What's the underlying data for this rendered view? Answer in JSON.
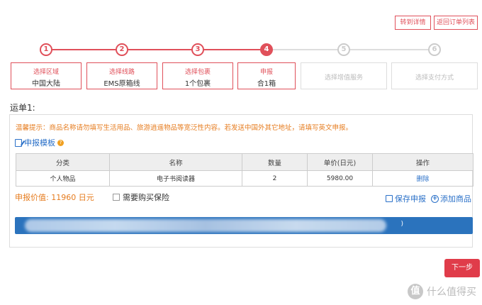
{
  "header": {
    "to_detail": "转到详情",
    "back_to_list": "返回订单列表"
  },
  "steps": [
    {
      "num": "1",
      "label": "选择区域",
      "value": "中国大陆",
      "state": "done"
    },
    {
      "num": "2",
      "label": "选择线路",
      "value": "EMS原箱线",
      "state": "done"
    },
    {
      "num": "3",
      "label": "选择包裹",
      "value": "1个包裹",
      "state": "done"
    },
    {
      "num": "4",
      "label": "申报",
      "value": "合1箱",
      "state": "active"
    },
    {
      "num": "5",
      "label": "选择增值服务",
      "value": "",
      "state": "todo"
    },
    {
      "num": "6",
      "label": "选择支付方式",
      "value": "",
      "state": "todo"
    }
  ],
  "waybill": {
    "title": "运单1:",
    "tip": "温馨提示：商品名称请勿填写生活用品、旅游逍遥物品等宽泛性内容。若发送中国外其它地址，请填写英文申报。",
    "template_label": "申报模板",
    "table": {
      "headers": [
        "分类",
        "名称",
        "数量",
        "单价(日元)",
        "操作"
      ],
      "rows": [
        {
          "category": "个人物品",
          "name": "电子书阅读器",
          "qty": "2",
          "price": "5980.00",
          "action": "删除"
        }
      ]
    },
    "declared_value": "申报价值:   11960 日元",
    "insurance_label": "需要购买保险",
    "save_label": "保存申报",
    "add_label": "添加商品",
    "bar_end": ")"
  },
  "next_label": "下一步",
  "watermark": {
    "logo": "值",
    "text": "什么值得买"
  },
  "colors": {
    "accent": "#e0505a",
    "link": "#2a70c8",
    "warning": "#e67c1f",
    "bar": "#2b73bd"
  }
}
